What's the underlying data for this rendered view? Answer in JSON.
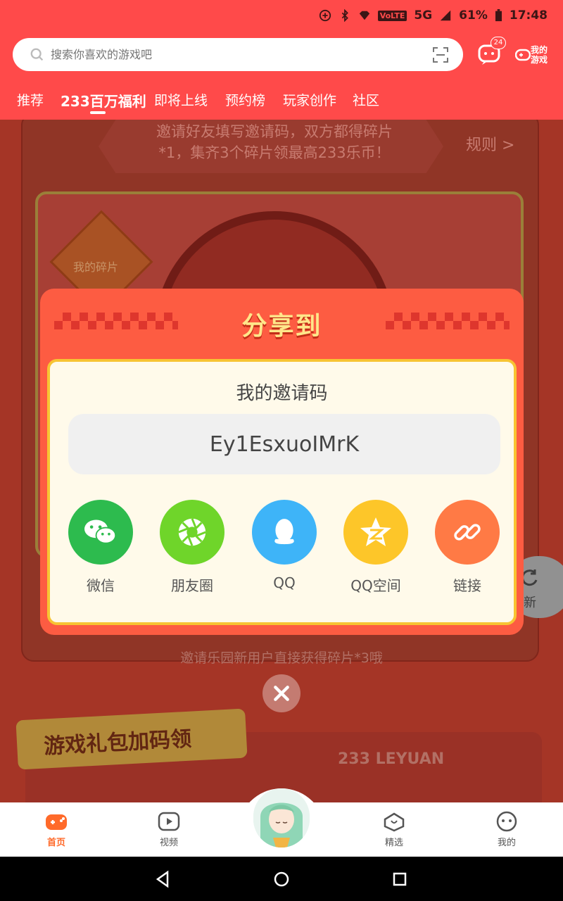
{
  "status_bar": {
    "network": "VoLTE",
    "signal": "5G",
    "battery": "61%",
    "time": "17:48"
  },
  "search": {
    "placeholder": "搜索你喜欢的游戏吧"
  },
  "header": {
    "message_badge": "24",
    "my_games_label": "我的\n游戏",
    "my_games_line1": "我的",
    "my_games_line2": "游戏"
  },
  "tabs": [
    {
      "label": "推荐"
    },
    {
      "label": "233百万福利"
    },
    {
      "label": "即将上线"
    },
    {
      "label": "预约榜"
    },
    {
      "label": "玩家创作"
    },
    {
      "label": "社区"
    }
  ],
  "background": {
    "banner_line1": "邀请好友填写邀请码，双方都得碎片",
    "banner_line2": "*1，集齐3个碎片领最高233乐币！",
    "rule_link": "规则 >",
    "my_fragments_label": "我的碎片",
    "bottom_note": "邀请乐园新用户直接获得碎片*3哦",
    "gift_title": "游戏礼包加码领",
    "leyuan_text": "233 LEYUAN",
    "refresh_label": "新"
  },
  "modal": {
    "title": "分享到",
    "invite_label": "我的邀请码",
    "invite_code": "Ey1EsxuoIMrK",
    "share_options": [
      {
        "label": "微信",
        "icon": "wechat-icon",
        "color": "#2dbb4e"
      },
      {
        "label": "朋友圈",
        "icon": "moments-icon",
        "color": "#6fd52a"
      },
      {
        "label": "QQ",
        "icon": "qq-icon",
        "color": "#3eb4f8"
      },
      {
        "label": "QQ空间",
        "icon": "qzone-icon",
        "color": "#fdc629"
      },
      {
        "label": "链接",
        "icon": "link-icon",
        "color": "#ff7a45"
      }
    ]
  },
  "bottom_nav": [
    {
      "label": "首页",
      "icon": "home-gamepad-icon",
      "active": true
    },
    {
      "label": "视频",
      "icon": "video-icon",
      "active": false
    },
    {
      "label": "精选",
      "icon": "featured-heart-icon",
      "active": false
    },
    {
      "label": "我的",
      "icon": "profile-face-icon",
      "active": false
    }
  ],
  "colors": {
    "brand": "#ff4a4a",
    "modal_bg": "#fd5c42",
    "modal_title": "#ffe68a",
    "active_nav": "#ff6a2a"
  }
}
